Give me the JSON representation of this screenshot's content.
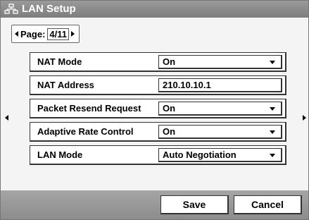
{
  "window": {
    "title": "LAN Setup",
    "title_icon": "network-icon"
  },
  "page_nav": {
    "label": "Page:",
    "value": "4/11"
  },
  "settings": [
    {
      "label": "NAT Mode",
      "value": "On",
      "type": "dropdown"
    },
    {
      "label": "NAT Address",
      "value": "210.10.10.1",
      "type": "text"
    },
    {
      "label": "Packet Resend Request",
      "value": "On",
      "type": "dropdown"
    },
    {
      "label": "Adaptive Rate Control",
      "value": "On",
      "type": "dropdown"
    },
    {
      "label": "LAN Mode",
      "value": "Auto Negotiation",
      "type": "dropdown"
    }
  ],
  "buttons": {
    "save": "Save",
    "cancel": "Cancel"
  },
  "colors": {
    "title_bar": "#8a8a8a",
    "bottom_bar": "#999999",
    "background": "#f4f4f4"
  }
}
